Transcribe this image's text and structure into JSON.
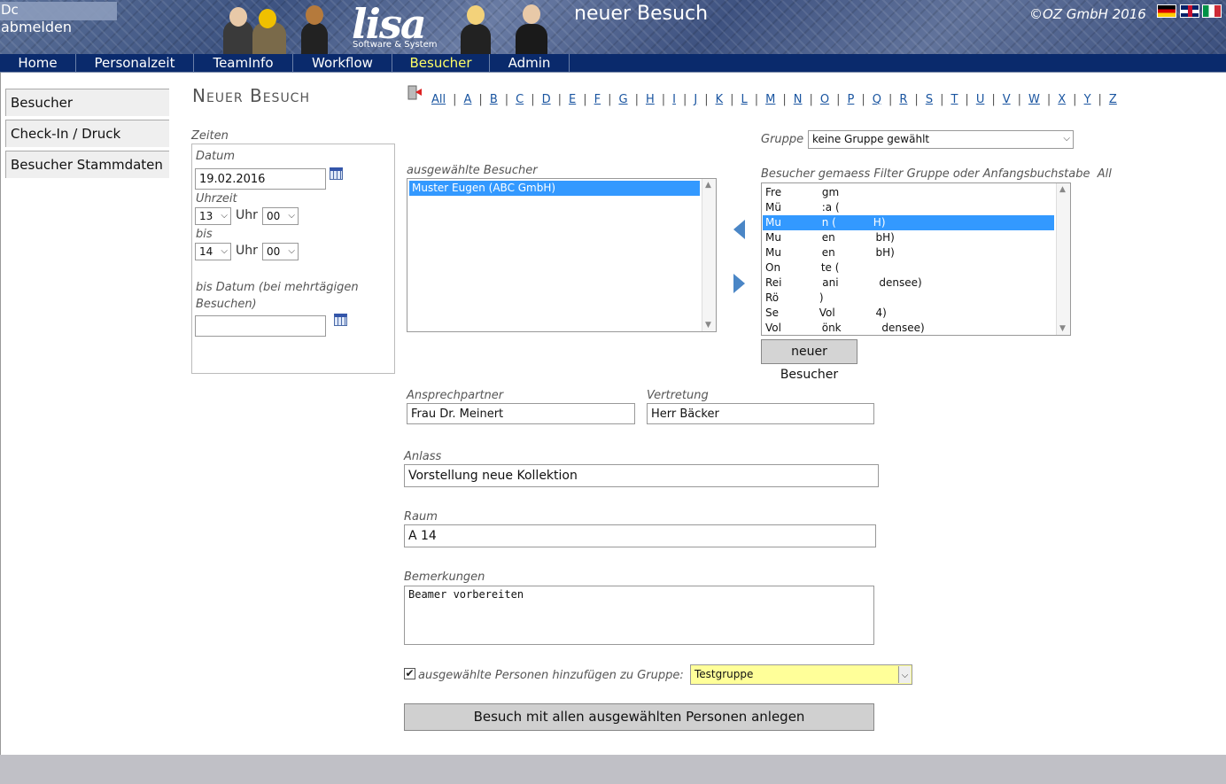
{
  "header": {
    "user_name": "Dc",
    "logout": "abmelden",
    "logo": "lisa",
    "logo_sub": "Software & System",
    "page_heading": "neuer Besuch",
    "copyright": "©OZ GmbH 2016"
  },
  "nav": [
    "Home",
    "Personalzeit",
    "TeamInfo",
    "Workflow",
    "Besucher",
    "Admin"
  ],
  "nav_active": "Besucher",
  "sidebar": [
    "Besucher",
    "Check-In / Druck",
    "Besucher Stammdaten"
  ],
  "title": "Neuer Besuch",
  "times": {
    "section_label": "Zeiten",
    "date_label": "Datum",
    "date_value": "19.02.2016",
    "time_label": "Uhrzeit",
    "from_hour": "13",
    "from_min": "00",
    "uhr": "Uhr",
    "until_label": "bis",
    "to_hour": "14",
    "to_min": "00",
    "end_date_label": "bis Datum (bei mehrtägigen Besuchen)",
    "end_date_value": ""
  },
  "alphabet": [
    "All",
    "A",
    "B",
    "C",
    "D",
    "E",
    "F",
    "G",
    "H",
    "I",
    "J",
    "K",
    "L",
    "M",
    "N",
    "O",
    "P",
    "Q",
    "R",
    "S",
    "T",
    "U",
    "V",
    "W",
    "X",
    "Y",
    "Z"
  ],
  "selected_label": "ausgewählte Besucher",
  "selected_visitors": [
    "Muster Eugen (ABC GmbH)"
  ],
  "group_label": "Gruppe",
  "group_value": "keine Gruppe gewählt",
  "filter_label": "Besucher gemaess Filter Gruppe oder Anfangsbuchstabe",
  "filter_value": "All",
  "filter_list": [
    "Fre            gm",
    "Mü            :a (",
    "Mu            n (           H)",
    "Mu            en            bH)",
    "Mu            en            bH)",
    "On            te (",
    "Rei            ani            densee)",
    "Rö            )",
    "Se            Vol            4)",
    "Vol            önk            densee)"
  ],
  "filter_selected_index": 2,
  "new_visitor_button": "neuer Besucher",
  "contact_label": "Ansprechpartner",
  "contact_value": "Frau Dr. Meinert",
  "deputy_label": "Vertretung",
  "deputy_value": "Herr Bäcker",
  "reason_label": "Anlass",
  "reason_value": "Vorstellung neue Kollektion",
  "room_label": "Raum",
  "room_value": "A 14",
  "notes_label": "Bemerkungen",
  "notes_value": "Beamer vorbereiten",
  "add_group_label": "ausgewählte Personen hinzufügen zu Gruppe:",
  "add_group_value": "Testgruppe",
  "submit_button": "Besuch mit allen ausgewählten Personen anlegen",
  "colors": {
    "nav_bg": "#0a2a6c",
    "active_nav": "#ffff66",
    "selection": "#3399ff",
    "highlight_select": "#ffff99"
  }
}
